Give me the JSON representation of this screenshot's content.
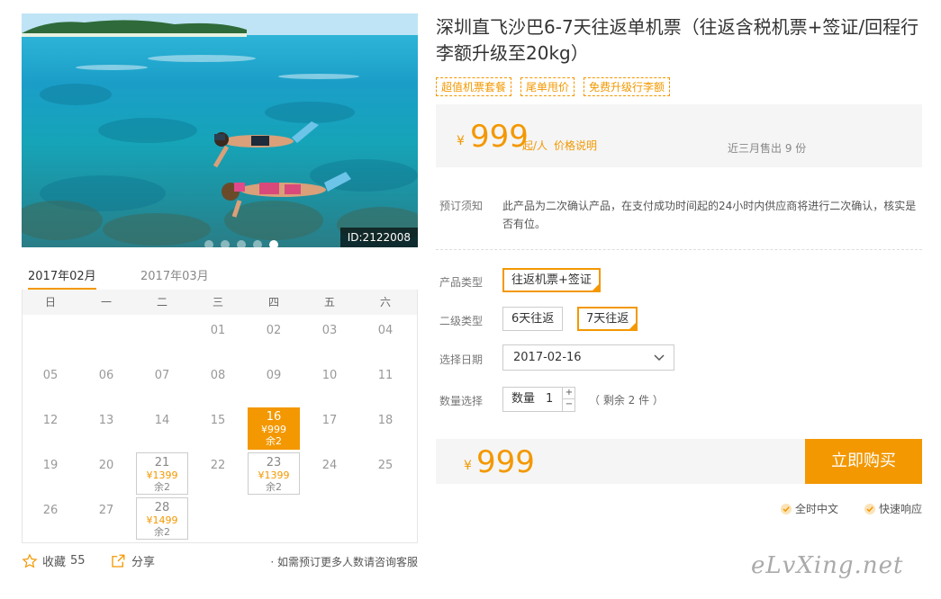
{
  "product": {
    "title": "深圳直飞沙巴6-7天往返单机票（往返含税机票+签证/回程行李额升级至20kg）",
    "tags": [
      "超值机票套餐",
      "尾单甩价",
      "免费升级行李额"
    ],
    "photo_id": "ID:2122008"
  },
  "price": {
    "currency": "¥",
    "amount": "999",
    "unit": "起/人",
    "info_link": "价格说明",
    "sold": "近三月售出 9 份"
  },
  "notice": {
    "label": "预订须知",
    "text": "此产品为二次确认产品，在支付成功时间起的24小时内供应商将进行二次确认，核实是否有位。"
  },
  "options": {
    "product_type_label": "产品类型",
    "product_type": "往返机票+签证",
    "sub_type_label": "二级类型",
    "sub_types": [
      "6天往返",
      "7天往返"
    ],
    "date_label": "选择日期",
    "date": "2017-02-16",
    "qty_label": "数量选择",
    "qty_text": "数量",
    "qty_value": "1",
    "remain": "（ 剩余 2 件 ）"
  },
  "buy": {
    "currency": "¥",
    "total": "999",
    "button": "立即购买"
  },
  "features": [
    "全时中文",
    "快速响应"
  ],
  "calendar": {
    "tabs": [
      "2017年02月",
      "2017年03月"
    ],
    "weekdays": [
      "日",
      "一",
      "二",
      "三",
      "四",
      "五",
      "六"
    ],
    "days": [
      "01",
      "02",
      "03",
      "04",
      "05",
      "06",
      "07",
      "08",
      "09",
      "10",
      "11",
      "12",
      "13",
      "14",
      "15",
      "16",
      "17",
      "18",
      "19",
      "20",
      "21",
      "22",
      "23",
      "24",
      "25",
      "26",
      "27",
      "28"
    ],
    "avail": {
      "16": {
        "price": "¥999",
        "left": "余2",
        "selected": true
      },
      "21": {
        "price": "¥1399",
        "left": "余2"
      },
      "23": {
        "price": "¥1399",
        "left": "余2"
      },
      "28": {
        "price": "¥1499",
        "left": "余2"
      }
    }
  },
  "social": {
    "fav_label": "收藏",
    "fav_count": "55",
    "share_label": "分享",
    "consult": "· 如需预订更多人数请咨询客服"
  },
  "watermark": "eLvXing.net",
  "colors": {
    "accent": "#f39800"
  }
}
